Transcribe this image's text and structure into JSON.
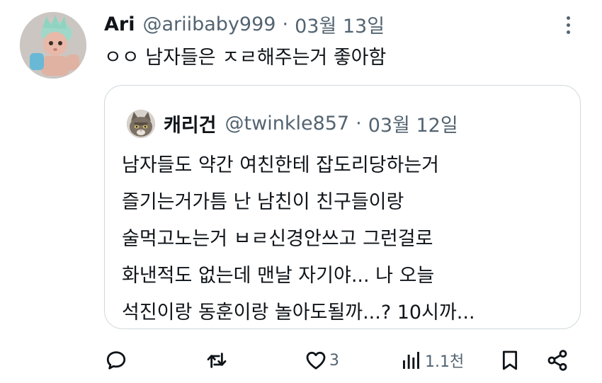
{
  "tweet": {
    "author_name": "Ari",
    "handle": "@ariibaby999",
    "separator": "·",
    "date": "03월 13일",
    "text": "ㅇㅇ 남자들은 ㅈㄹ해주는거 좋아함",
    "avatar": "doll-avatar",
    "more_icon": "more-vertical-icon"
  },
  "quote": {
    "author_name": "캐리건",
    "handle": "@twinkle857",
    "separator": "·",
    "date": "03월 12일",
    "avatar": "cat-avatar",
    "lines": [
      "남자들도 약간 여친한테 잡도리당하는거",
      "즐기는거가틈 난 남친이 친구들이랑",
      "술먹고노는거 ㅂㄹ신경안쓰고 그런걸로",
      "화낸적도 없는데 맨날 자기야... 나 오늘",
      "석진이랑 동훈이랑 놀아도될까...? 10시까..."
    ]
  },
  "actions": {
    "reply": {
      "icon": "reply-icon",
      "count": ""
    },
    "retweet": {
      "icon": "retweet-icon",
      "count": ""
    },
    "like": {
      "icon": "heart-icon",
      "count": "3"
    },
    "views": {
      "icon": "views-icon",
      "count": "1.1천"
    },
    "bookmark": {
      "icon": "bookmark-icon",
      "count": ""
    },
    "share": {
      "icon": "share-icon",
      "count": ""
    }
  },
  "colors": {
    "text": "#0f1419",
    "secondary": "#536471",
    "border": "#cfd9de",
    "background": "#ffffff"
  }
}
